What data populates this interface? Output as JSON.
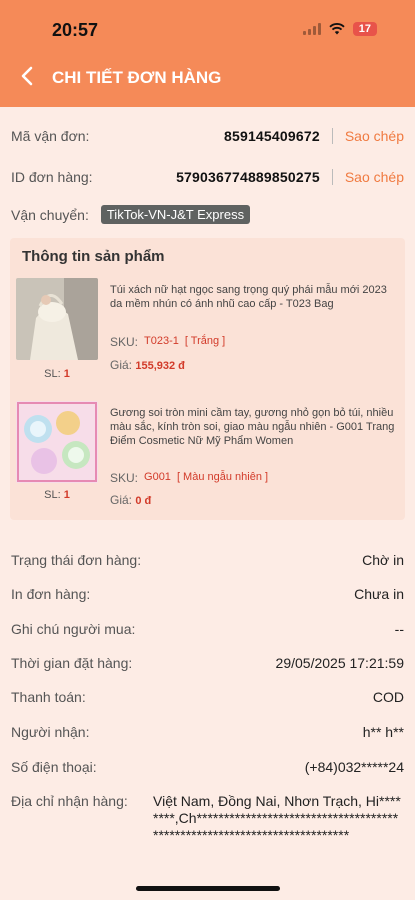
{
  "status": {
    "time": "20:57",
    "battery": "17"
  },
  "header": {
    "title": "CHI TIẾT ĐƠN HÀNG"
  },
  "tracking": {
    "label": "Mã vận đơn:",
    "value": "859145409672",
    "copy": "Sao chép"
  },
  "order_id": {
    "label": "ID đơn hàng:",
    "value": "579036774889850275",
    "copy": "Sao chép"
  },
  "shipping": {
    "label": "Vận chuyển:",
    "carrier": "TikTok-VN-J&T Express"
  },
  "products": {
    "title": "Thông tin sản phẩm",
    "items": [
      {
        "name": "Túi xách nữ hạt ngọc sang trọng quý phái mẫu mới 2023 da mềm nhún có ánh nhũ cao cấp - T023 Bag",
        "sku_label": "SKU:",
        "sku": "T023-1",
        "variant": "[ Trắng ]",
        "price_label": "Giá:",
        "price": "155,932 đ",
        "qty_label": "SL:",
        "qty": "1"
      },
      {
        "name": "Gương soi tròn mini cầm tay, gương nhỏ gọn bỏ túi, nhiều màu sắc, kính tròn soi, giao màu ngẫu nhiên - G001 Trang Điểm Cosmetic Nữ Mỹ Phẩm Women",
        "sku_label": "SKU:",
        "sku": "G001",
        "variant": "[ Màu ngẫu nhiên ]",
        "price_label": "Giá:",
        "price": "0 đ",
        "qty_label": "SL:",
        "qty": "1"
      }
    ]
  },
  "details": {
    "status_label": "Trạng thái đơn hàng:",
    "status_value": "Chờ in",
    "print_label": "In đơn hàng:",
    "print_value": "Chưa in",
    "note_label": "Ghi chú người mua:",
    "note_value": "--",
    "time_label": "Thời gian đặt hàng:",
    "time_value": "29/05/2025 17:21:59",
    "payment_label": "Thanh toán:",
    "payment_value": "COD",
    "receiver_label": "Người nhận:",
    "receiver_value": "h** h**",
    "phone_label": "Số điện thoại:",
    "phone_value": "(+84)032*****24",
    "address_label": "Địa chỉ nhận hàng:",
    "address_value": "Việt Nam, Đồng Nai, Nhơn Trạch, Hi********,Ch*************************************************************************"
  }
}
